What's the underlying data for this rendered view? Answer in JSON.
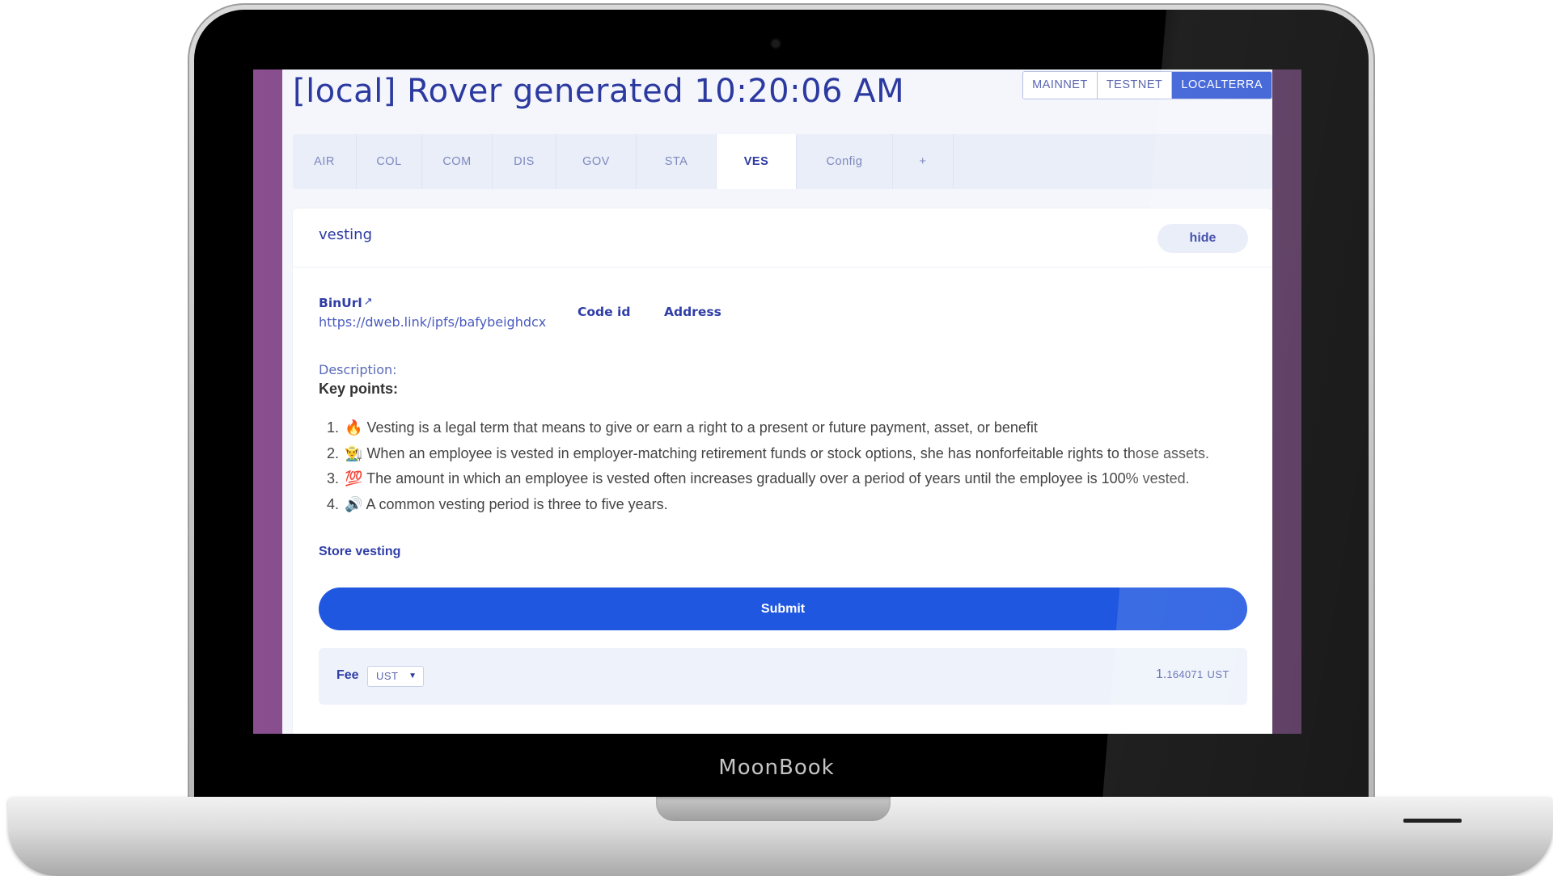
{
  "device": {
    "brand": "MoonBook"
  },
  "app": {
    "title": "[local] Rover generated 10:20:06 AM"
  },
  "networks": [
    {
      "label": "MAINNET",
      "active": false
    },
    {
      "label": "TESTNET",
      "active": false
    },
    {
      "label": "LOCALTERRA",
      "active": true
    }
  ],
  "tabs": [
    {
      "label": "AIR",
      "active": false
    },
    {
      "label": "COL",
      "active": false
    },
    {
      "label": "COM",
      "active": false
    },
    {
      "label": "DIS",
      "active": false
    },
    {
      "label": "GOV",
      "active": false
    },
    {
      "label": "STA",
      "active": false
    },
    {
      "label": "VES",
      "active": true
    },
    {
      "label": "Config",
      "active": false
    },
    {
      "label": "+",
      "active": false
    }
  ],
  "contract": {
    "name": "vesting",
    "hide_label": "hide",
    "binurl_label": "BinUrl",
    "binurl_icon": "external-link-icon",
    "binurl_value": "https://dweb.link/ipfs/bafybeighdcxyz",
    "code_id_label": "Code id",
    "address_label": "Address",
    "description_label": "Description:",
    "key_points_heading": "Key points:",
    "key_points": [
      {
        "emoji": "🔥",
        "text": "Vesting is a legal term that means to give or earn a right to a present or future payment, asset, or benefit"
      },
      {
        "emoji": "👨‍🌾",
        "text": "When an employee is vested in employer-matching retirement funds or stock options, she has nonforfeitable rights to those assets."
      },
      {
        "emoji": "💯",
        "text": "The amount in which an employee is vested often increases gradually over a period of years until the employee is 100% vested."
      },
      {
        "emoji": "🔊",
        "text": "A common vesting period is three to five years."
      }
    ],
    "store_label": "Store vesting",
    "submit_label": "Submit"
  },
  "fee": {
    "label": "Fee",
    "currency": "UST",
    "amount_int": "1.",
    "amount_dec": "164071",
    "amount_unit": "UST"
  },
  "colors": {
    "accent": "#1f57e0",
    "title": "#2c3aa0",
    "sidebar": "#8a4f8f"
  }
}
